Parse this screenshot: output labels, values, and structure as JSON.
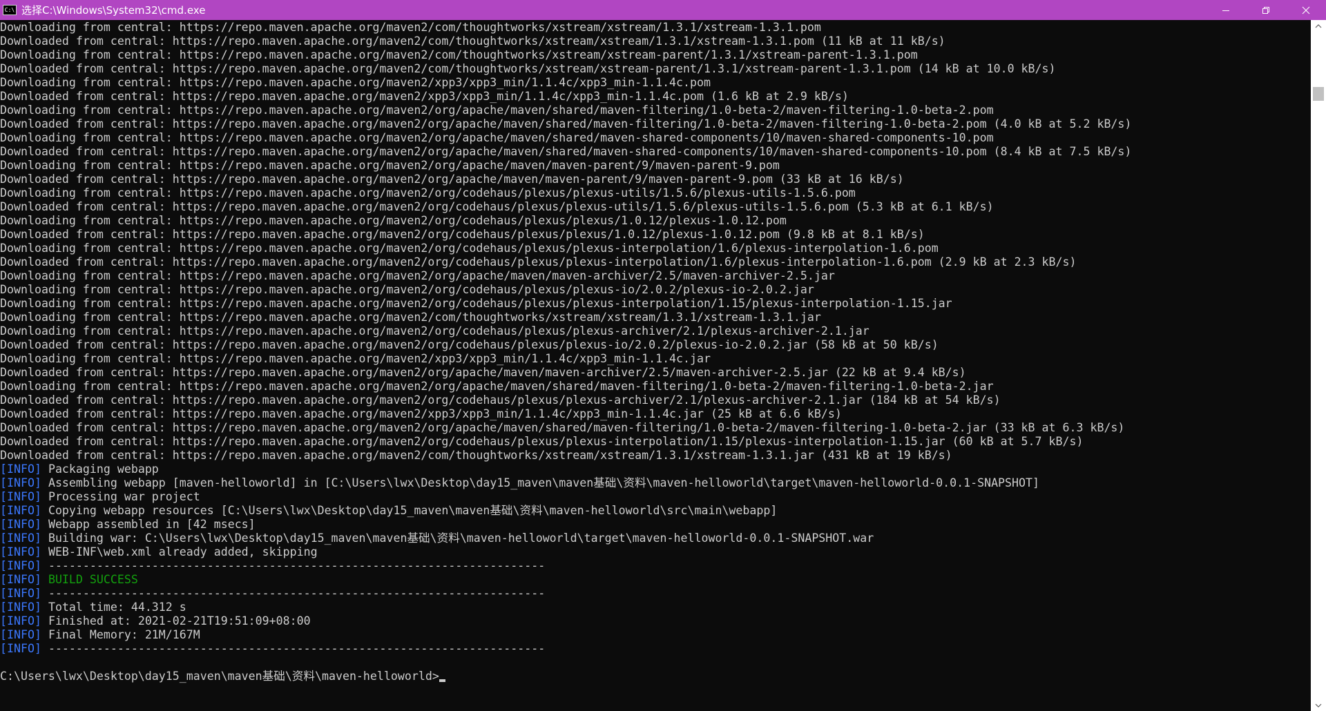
{
  "window": {
    "title": "选择C:\\Windows\\System32\\cmd.exe",
    "icon_text": "C:\\",
    "controls": [
      "minimize-icon",
      "restore-icon",
      "close-icon"
    ]
  },
  "colors": {
    "titlebar": "#b146c2",
    "console_bg": "#0c0c0c",
    "console_fg": "#cccccc",
    "info_tag": "#3b78ff",
    "success": "#13a10e"
  },
  "console": {
    "lines": [
      {
        "tag": "",
        "text": "Downloading from central: https://repo.maven.apache.org/maven2/com/thoughtworks/xstream/xstream/1.3.1/xstream-1.3.1.pom",
        "success": false
      },
      {
        "tag": "",
        "text": "Downloaded from central: https://repo.maven.apache.org/maven2/com/thoughtworks/xstream/xstream/1.3.1/xstream-1.3.1.pom (11 kB at 11 kB/s)",
        "success": false
      },
      {
        "tag": "",
        "text": "Downloading from central: https://repo.maven.apache.org/maven2/com/thoughtworks/xstream/xstream-parent/1.3.1/xstream-parent-1.3.1.pom",
        "success": false
      },
      {
        "tag": "",
        "text": "Downloaded from central: https://repo.maven.apache.org/maven2/com/thoughtworks/xstream/xstream-parent/1.3.1/xstream-parent-1.3.1.pom (14 kB at 10.0 kB/s)",
        "success": false
      },
      {
        "tag": "",
        "text": "Downloading from central: https://repo.maven.apache.org/maven2/xpp3/xpp3_min/1.1.4c/xpp3_min-1.1.4c.pom",
        "success": false
      },
      {
        "tag": "",
        "text": "Downloaded from central: https://repo.maven.apache.org/maven2/xpp3/xpp3_min/1.1.4c/xpp3_min-1.1.4c.pom (1.6 kB at 2.9 kB/s)",
        "success": false
      },
      {
        "tag": "",
        "text": "Downloading from central: https://repo.maven.apache.org/maven2/org/apache/maven/shared/maven-filtering/1.0-beta-2/maven-filtering-1.0-beta-2.pom",
        "success": false
      },
      {
        "tag": "",
        "text": "Downloaded from central: https://repo.maven.apache.org/maven2/org/apache/maven/shared/maven-filtering/1.0-beta-2/maven-filtering-1.0-beta-2.pom (4.0 kB at 5.2 kB/s)",
        "success": false
      },
      {
        "tag": "",
        "text": "Downloading from central: https://repo.maven.apache.org/maven2/org/apache/maven/shared/maven-shared-components/10/maven-shared-components-10.pom",
        "success": false
      },
      {
        "tag": "",
        "text": "Downloaded from central: https://repo.maven.apache.org/maven2/org/apache/maven/shared/maven-shared-components/10/maven-shared-components-10.pom (8.4 kB at 7.5 kB/s)",
        "success": false
      },
      {
        "tag": "",
        "text": "Downloading from central: https://repo.maven.apache.org/maven2/org/apache/maven/maven-parent/9/maven-parent-9.pom",
        "success": false
      },
      {
        "tag": "",
        "text": "Downloaded from central: https://repo.maven.apache.org/maven2/org/apache/maven/maven-parent/9/maven-parent-9.pom (33 kB at 16 kB/s)",
        "success": false
      },
      {
        "tag": "",
        "text": "Downloading from central: https://repo.maven.apache.org/maven2/org/codehaus/plexus/plexus-utils/1.5.6/plexus-utils-1.5.6.pom",
        "success": false
      },
      {
        "tag": "",
        "text": "Downloaded from central: https://repo.maven.apache.org/maven2/org/codehaus/plexus/plexus-utils/1.5.6/plexus-utils-1.5.6.pom (5.3 kB at 6.1 kB/s)",
        "success": false
      },
      {
        "tag": "",
        "text": "Downloading from central: https://repo.maven.apache.org/maven2/org/codehaus/plexus/plexus/1.0.12/plexus-1.0.12.pom",
        "success": false
      },
      {
        "tag": "",
        "text": "Downloaded from central: https://repo.maven.apache.org/maven2/org/codehaus/plexus/plexus/1.0.12/plexus-1.0.12.pom (9.8 kB at 8.1 kB/s)",
        "success": false
      },
      {
        "tag": "",
        "text": "Downloading from central: https://repo.maven.apache.org/maven2/org/codehaus/plexus/plexus-interpolation/1.6/plexus-interpolation-1.6.pom",
        "success": false
      },
      {
        "tag": "",
        "text": "Downloaded from central: https://repo.maven.apache.org/maven2/org/codehaus/plexus/plexus-interpolation/1.6/plexus-interpolation-1.6.pom (2.9 kB at 2.3 kB/s)",
        "success": false
      },
      {
        "tag": "",
        "text": "Downloading from central: https://repo.maven.apache.org/maven2/org/apache/maven/maven-archiver/2.5/maven-archiver-2.5.jar",
        "success": false
      },
      {
        "tag": "",
        "text": "Downloading from central: https://repo.maven.apache.org/maven2/org/codehaus/plexus/plexus-io/2.0.2/plexus-io-2.0.2.jar",
        "success": false
      },
      {
        "tag": "",
        "text": "Downloading from central: https://repo.maven.apache.org/maven2/org/codehaus/plexus/plexus-interpolation/1.15/plexus-interpolation-1.15.jar",
        "success": false
      },
      {
        "tag": "",
        "text": "Downloading from central: https://repo.maven.apache.org/maven2/com/thoughtworks/xstream/xstream/1.3.1/xstream-1.3.1.jar",
        "success": false
      },
      {
        "tag": "",
        "text": "Downloading from central: https://repo.maven.apache.org/maven2/org/codehaus/plexus/plexus-archiver/2.1/plexus-archiver-2.1.jar",
        "success": false
      },
      {
        "tag": "",
        "text": "Downloaded from central: https://repo.maven.apache.org/maven2/org/codehaus/plexus/plexus-io/2.0.2/plexus-io-2.0.2.jar (58 kB at 50 kB/s)",
        "success": false
      },
      {
        "tag": "",
        "text": "Downloading from central: https://repo.maven.apache.org/maven2/xpp3/xpp3_min/1.1.4c/xpp3_min-1.1.4c.jar",
        "success": false
      },
      {
        "tag": "",
        "text": "Downloaded from central: https://repo.maven.apache.org/maven2/org/apache/maven/maven-archiver/2.5/maven-archiver-2.5.jar (22 kB at 9.4 kB/s)",
        "success": false
      },
      {
        "tag": "",
        "text": "Downloading from central: https://repo.maven.apache.org/maven2/org/apache/maven/shared/maven-filtering/1.0-beta-2/maven-filtering-1.0-beta-2.jar",
        "success": false
      },
      {
        "tag": "",
        "text": "Downloaded from central: https://repo.maven.apache.org/maven2/org/codehaus/plexus/plexus-archiver/2.1/plexus-archiver-2.1.jar (184 kB at 54 kB/s)",
        "success": false
      },
      {
        "tag": "",
        "text": "Downloaded from central: https://repo.maven.apache.org/maven2/xpp3/xpp3_min/1.1.4c/xpp3_min-1.1.4c.jar (25 kB at 6.6 kB/s)",
        "success": false
      },
      {
        "tag": "",
        "text": "Downloaded from central: https://repo.maven.apache.org/maven2/org/apache/maven/shared/maven-filtering/1.0-beta-2/maven-filtering-1.0-beta-2.jar (33 kB at 6.3 kB/s)",
        "success": false
      },
      {
        "tag": "",
        "text": "Downloaded from central: https://repo.maven.apache.org/maven2/org/codehaus/plexus/plexus-interpolation/1.15/plexus-interpolation-1.15.jar (60 kB at 5.7 kB/s)",
        "success": false
      },
      {
        "tag": "",
        "text": "Downloaded from central: https://repo.maven.apache.org/maven2/com/thoughtworks/xstream/xstream/1.3.1/xstream-1.3.1.jar (431 kB at 19 kB/s)",
        "success": false
      },
      {
        "tag": "[INFO]",
        "text": "Packaging webapp",
        "success": false
      },
      {
        "tag": "[INFO]",
        "text": "Assembling webapp [maven-helloworld] in [C:\\Users\\lwx\\Desktop\\day15_maven\\maven基础\\资料\\maven-helloworld\\target\\maven-helloworld-0.0.1-SNAPSHOT]",
        "success": false
      },
      {
        "tag": "[INFO]",
        "text": "Processing war project",
        "success": false
      },
      {
        "tag": "[INFO]",
        "text": "Copying webapp resources [C:\\Users\\lwx\\Desktop\\day15_maven\\maven基础\\资料\\maven-helloworld\\src\\main\\webapp]",
        "success": false
      },
      {
        "tag": "[INFO]",
        "text": "Webapp assembled in [42 msecs]",
        "success": false
      },
      {
        "tag": "[INFO]",
        "text": "Building war: C:\\Users\\lwx\\Desktop\\day15_maven\\maven基础\\资料\\maven-helloworld\\target\\maven-helloworld-0.0.1-SNAPSHOT.war",
        "success": false
      },
      {
        "tag": "[INFO]",
        "text": "WEB-INF\\web.xml already added, skipping",
        "success": false
      },
      {
        "tag": "[INFO]",
        "text": "------------------------------------------------------------------------",
        "success": false
      },
      {
        "tag": "[INFO]",
        "text": "BUILD SUCCESS",
        "success": true
      },
      {
        "tag": "[INFO]",
        "text": "------------------------------------------------------------------------",
        "success": false
      },
      {
        "tag": "[INFO]",
        "text": "Total time: 44.312 s",
        "success": false
      },
      {
        "tag": "[INFO]",
        "text": "Finished at: 2021-02-21T19:51:09+08:00",
        "success": false
      },
      {
        "tag": "[INFO]",
        "text": "Final Memory: 21M/167M",
        "success": false
      },
      {
        "tag": "[INFO]",
        "text": "------------------------------------------------------------------------",
        "success": false
      },
      {
        "tag": "",
        "text": "",
        "success": false
      }
    ],
    "prompt": "C:\\Users\\lwx\\Desktop\\day15_maven\\maven基础\\资料\\maven-helloworld>"
  },
  "scrollbar": {
    "up_icon": "chevron-up-icon",
    "down_icon": "chevron-down-icon"
  }
}
